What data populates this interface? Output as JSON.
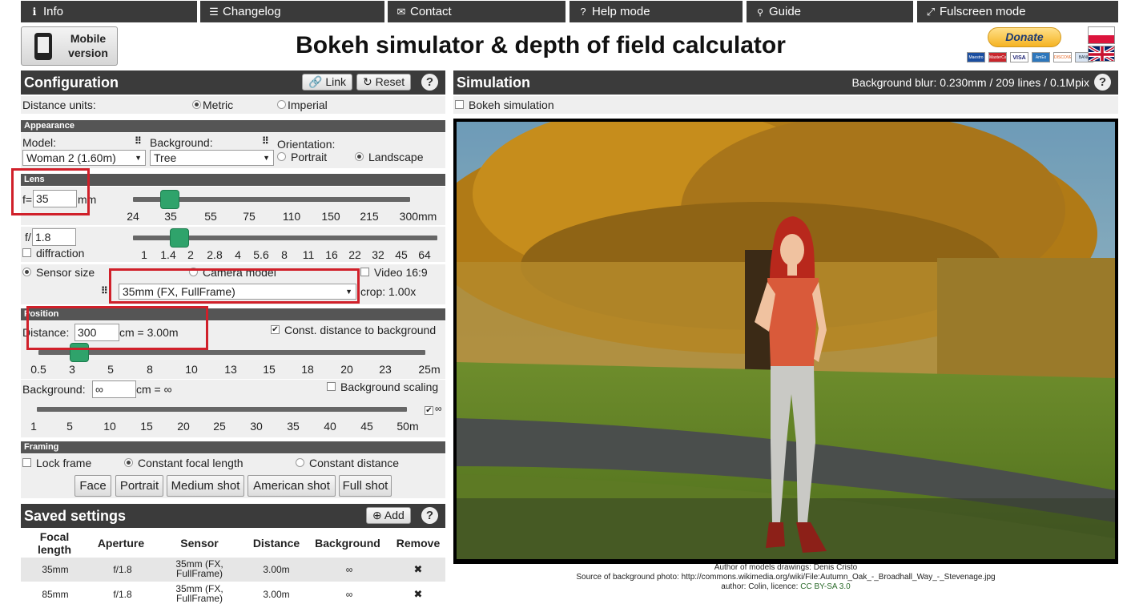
{
  "nav": [
    {
      "icon": "info-icon",
      "glyph": "ℹ",
      "label": "Info"
    },
    {
      "icon": "list-icon",
      "glyph": "☰",
      "label": "Changelog"
    },
    {
      "icon": "envelope-icon",
      "glyph": "✉",
      "label": "Contact"
    },
    {
      "icon": "question-icon",
      "glyph": "?",
      "label": "Help mode"
    },
    {
      "icon": "bulb-icon",
      "glyph": "💡",
      "label": "Guide"
    },
    {
      "icon": "fullscreen-icon",
      "glyph": "⤢",
      "label": "Fulscreen mode"
    }
  ],
  "header": {
    "mobile_line1": "Mobile",
    "mobile_line2": "version",
    "title": "Bokeh simulator & depth of field calculator",
    "donate": "Donate",
    "cards": [
      "Maestro",
      "MasterCard",
      "VISA",
      "AmEx",
      "DISCOVER",
      "BANK"
    ]
  },
  "config": {
    "title": "Configuration",
    "link": "Link",
    "reset": "Reset",
    "help": "?",
    "distance_units_label": "Distance units:",
    "metric": "Metric",
    "imperial": "Imperial",
    "appearance": {
      "title": "Appearance",
      "model_label": "Model:",
      "model_value": "Woman 2 (1.60m)",
      "background_label": "Background:",
      "background_value": "Tree",
      "orientation_label": "Orientation:",
      "portrait": "Portrait",
      "landscape": "Landscape"
    },
    "lens": {
      "title": "Lens",
      "f_label": "f=",
      "f_value": "35",
      "f_unit": "mm",
      "focal_ticks": [
        "24",
        "35",
        "55",
        "75",
        "110",
        "150",
        "215",
        "300mm"
      ],
      "aperture_label": "f/",
      "aperture_value": "1.8",
      "diffraction": "diffraction",
      "aperture_ticks": [
        "1",
        "1.4",
        "2",
        "2.8",
        "4",
        "5.6",
        "8",
        "11",
        "16",
        "22",
        "32",
        "45",
        "64"
      ],
      "sensor_size": "Sensor size",
      "camera_model": "Camera model",
      "video": "Video 16:9",
      "sensor_value": "35mm (FX, FullFrame)",
      "crop": "crop: 1.00x"
    },
    "position": {
      "title": "Position",
      "distance_label": "Distance:",
      "distance_value": "300",
      "distance_result": "cm = 3.00m",
      "const_distance": "Const. distance to background",
      "distance_ticks": [
        "0.5",
        "3",
        "5",
        "8",
        "10",
        "13",
        "15",
        "18",
        "20",
        "23",
        "25m"
      ],
      "background_label": "Background:",
      "background_value": "∞",
      "background_result": "cm = ∞",
      "background_scaling": "Background scaling",
      "background_ticks": [
        "1",
        "5",
        "10",
        "15",
        "20",
        "25",
        "30",
        "35",
        "40",
        "45",
        "50m"
      ],
      "infinity": "∞"
    },
    "framing": {
      "title": "Framing",
      "lock_frame": "Lock frame",
      "const_focal": "Constant focal length",
      "const_distance": "Constant distance",
      "buttons": [
        "Face",
        "Portrait",
        "Medium shot",
        "American shot",
        "Full shot"
      ]
    }
  },
  "saved": {
    "title": "Saved settings",
    "add": "Add",
    "help": "?",
    "columns": [
      "Focal length",
      "Aperture",
      "Sensor",
      "Distance",
      "Background",
      "Remove"
    ],
    "rows": [
      {
        "focal": "35mm",
        "aperture": "f/1.8",
        "sensor": "35mm (FX, FullFrame)",
        "distance": "3.00m",
        "background": "∞",
        "remove": "✖"
      },
      {
        "focal": "85mm",
        "aperture": "f/1.8",
        "sensor": "35mm (FX, FullFrame)",
        "distance": "3.00m",
        "background": "∞",
        "remove": "✖"
      }
    ]
  },
  "simulation": {
    "title": "Simulation",
    "blur": "Background blur: 0.230mm / 209 lines / 0.1Mpix",
    "help": "?",
    "bokeh": "Bokeh simulation",
    "footer_line1": "Author of models drawings: Denis Cristo",
    "footer_line2": "Source of background photo: http://commons.wikimedia.org/wiki/File:Autumn_Oak_-_Broadhall_Way_-_Stevenage.jpg",
    "footer_line3_prefix": "author: Colin, licence: ",
    "footer_license": "CC BY-SA 3.0"
  },
  "state": {
    "focal_fraction": 0.134,
    "aperture_fraction": 0.153,
    "distance_fraction": 0.105,
    "metric_selected": true,
    "landscape_selected": true,
    "sensor_size_selected": true,
    "const_distance_checked": true,
    "constant_focal_selected": true
  }
}
